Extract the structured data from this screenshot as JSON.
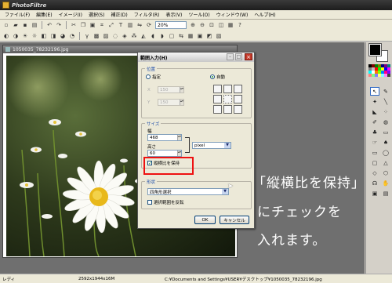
{
  "app": {
    "title": "PhotoFiltre",
    "icon": "photofiltre-icon"
  },
  "menu": [
    "ファイル(F)",
    "編集(E)",
    "イメージ(I)",
    "選択(S)",
    "補正(D)",
    "フィルタ(R)",
    "表示(V)",
    "ツール(O)",
    "ウィンドウ(W)",
    "ヘルプ(H)"
  ],
  "toolbar": {
    "zoom_value": "20%"
  },
  "document": {
    "title": "1050035_78232196.jpg"
  },
  "dialog": {
    "title": "範囲入力(H)",
    "position_group": "位置",
    "radio_specify": "指定",
    "radio_auto": "自動",
    "x_label": "X",
    "y_label": "Y",
    "x_value": "150",
    "y_value": "150",
    "size_group": "サイズ",
    "width_label": "幅",
    "width_value": "468",
    "height_label": "高さ",
    "height_value": "60",
    "unit_value": "pixel",
    "keep_ratio_label": "縦横比を保持",
    "keep_ratio_checked": true,
    "shape_group": "形状",
    "shape_value": "四角形選択",
    "invert_label": "選択範囲を反転",
    "ok_label": "OK",
    "cancel_label": "キャンセル",
    "close_symbol": "×"
  },
  "annotation": {
    "line1": "「縦横比を保持」",
    "line2": "にチェックを",
    "line3": "入れます。"
  },
  "status": {
    "ready": "レディ",
    "dimensions": "2592x1944x16M",
    "path": "C:¥Documents and Settings¥USER¥デスクトップ¥1050035_78232196.jpg"
  },
  "colors": {
    "highlight": "#ee1111",
    "workspace": "#6f6f6f",
    "annotation_text": "#ffffff"
  }
}
